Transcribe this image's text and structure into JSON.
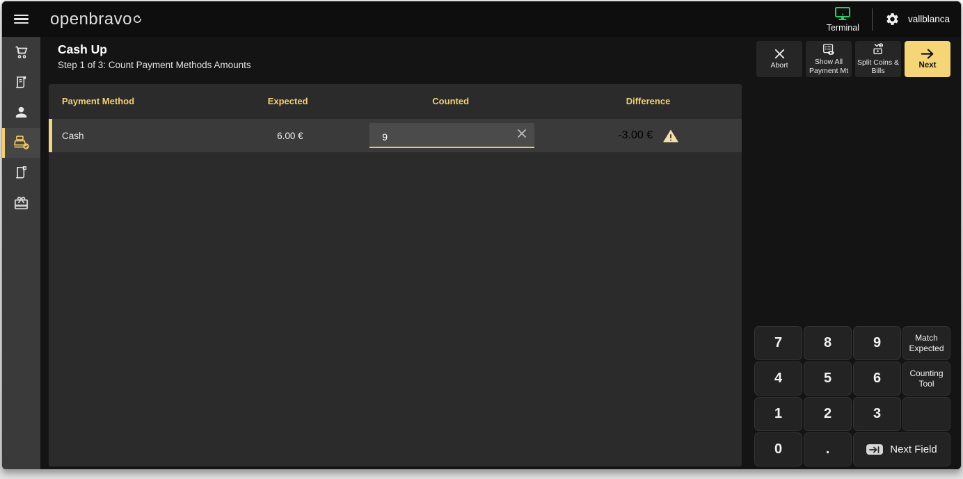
{
  "topbar": {
    "logo": "openbravo",
    "terminal_label": "Terminal",
    "username": "vallblanca"
  },
  "sidebar": {
    "items": [
      {
        "icon": "cart-icon"
      },
      {
        "icon": "receipt-icon"
      },
      {
        "icon": "person-icon"
      },
      {
        "icon": "cash-register-check-icon",
        "active": true
      },
      {
        "icon": "receipt-icon"
      },
      {
        "icon": "gift-icon"
      }
    ]
  },
  "header": {
    "title": "Cash Up",
    "subtitle": "Step 1 of 3: Count Payment Methods Amounts"
  },
  "actions": {
    "abort": "Abort",
    "show_all": "Show All Payment Mt",
    "split": "Split Coins & Bills",
    "next": "Next"
  },
  "table": {
    "columns": [
      "Payment Method",
      "Expected",
      "Counted",
      "Difference"
    ],
    "rows": [
      {
        "payment_method": "Cash",
        "expected": "6.00 €",
        "counted": "9",
        "difference": "-3.00 €",
        "warning": true
      }
    ]
  },
  "keypad": {
    "keys": [
      [
        "7",
        "8",
        "9",
        "Match Expected"
      ],
      [
        "4",
        "5",
        "6",
        "Counting Tool"
      ],
      [
        "1",
        "2",
        "3",
        ""
      ],
      [
        "0",
        ".",
        "Next Field"
      ]
    ]
  },
  "colors": {
    "accent_yellow": "#f5d576",
    "header_yellow": "#f2cf6f",
    "terminal_green": "#21d366",
    "warning_fill": "#f5dfa8",
    "row_bg": "#3a3a3a",
    "panel_bg": "#2b2b2b"
  },
  "icons": {
    "menu": "hamburger-icon",
    "settings": "gear-icon",
    "terminal": "monitor-icon",
    "abort": "close-icon",
    "show_all": "list-eye-icon",
    "split": "coins-bills-icon",
    "next": "arrow-right-icon",
    "clear": "clear-x-icon",
    "warning": "warning-triangle-icon",
    "next_field": "tab-icon"
  }
}
